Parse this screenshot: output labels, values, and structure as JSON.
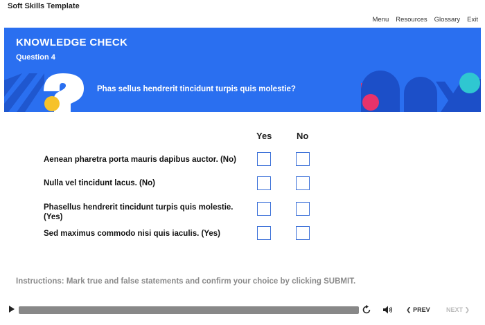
{
  "course": {
    "title": "Soft Skills Template"
  },
  "nav": {
    "menu": "Menu",
    "resources": "Resources",
    "glossary": "Glossary",
    "exit": "Exit"
  },
  "banner": {
    "heading": "KNOWLEDGE CHECK",
    "subheading": "Question 4",
    "question": "Phas sellus hendrerit tincidunt turpis quis molestie?",
    "colors": {
      "background": "#2a6ff0",
      "pink": "#e8336b",
      "yellow": "#f6c22a",
      "teal": "#2fc7d1",
      "dark_blue": "#1c4fc8"
    }
  },
  "table": {
    "yes_label": "Yes",
    "no_label": "No",
    "statements": [
      "Aenean pharetra porta mauris dapibus auctor. (No)",
      "Nulla vel tincidunt lacus. (No)",
      "Phasellus hendrerit tincidunt turpis quis molestie. (Yes)",
      "Sed maximus commodo nisi quis iaculis. (Yes)"
    ]
  },
  "instructions": "Instructions: Mark true and false statements and confirm your choice by clicking SUBMIT.",
  "player": {
    "prev": "PREV",
    "next": "NEXT"
  },
  "icons": {
    "play": "play-icon",
    "replay": "replay-icon",
    "volume": "volume-icon",
    "prev": "chevron-left-icon",
    "next": "chevron-right-icon"
  }
}
